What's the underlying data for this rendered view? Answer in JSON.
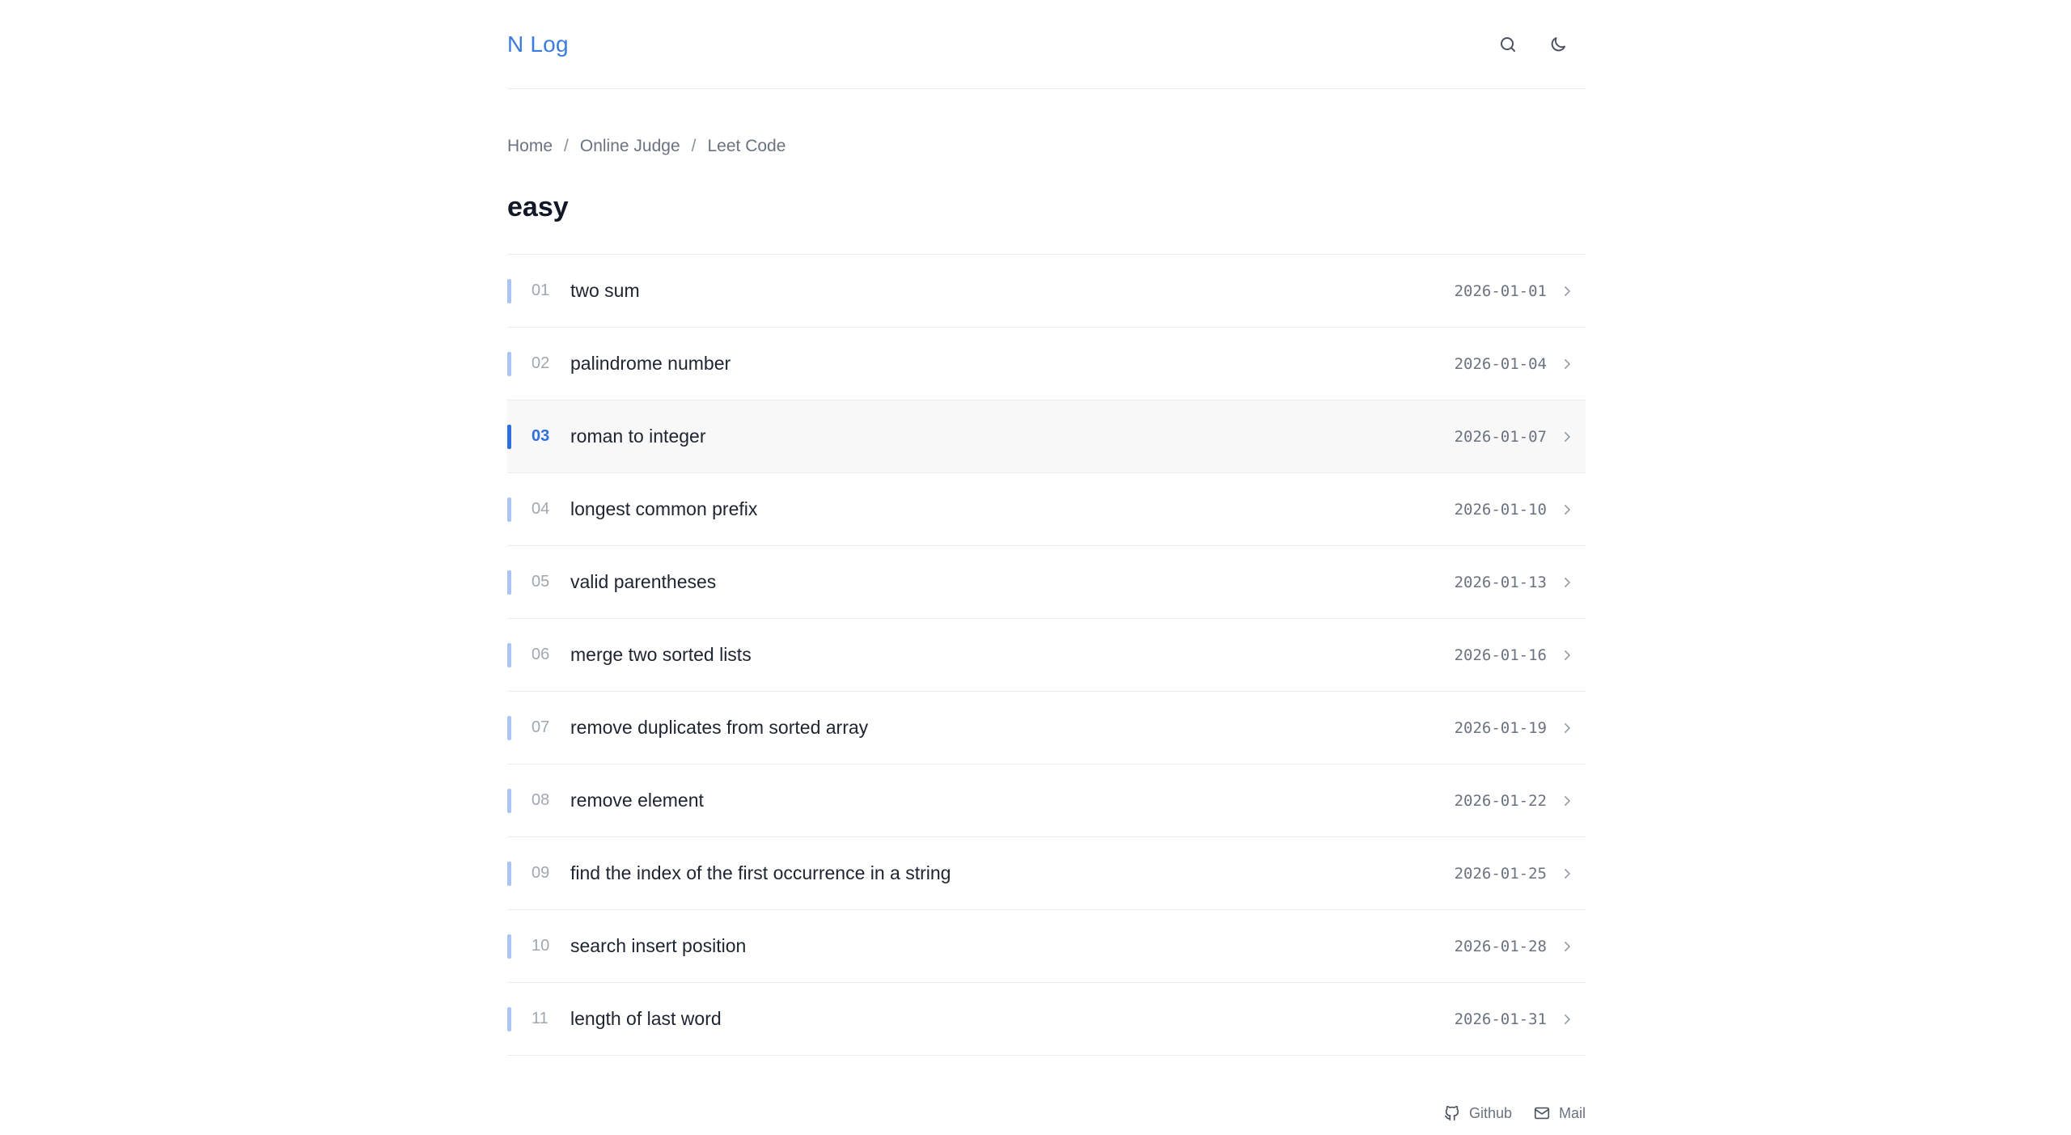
{
  "header": {
    "logo": "N Log",
    "search_icon": "search-icon",
    "theme_icon": "moon-icon"
  },
  "breadcrumb": [
    "Home",
    "Online Judge",
    "Leet Code"
  ],
  "breadcrumb_separator": "/",
  "page_title": "easy",
  "posts": [
    {
      "num": "01",
      "title": "two sum",
      "date": "2026-01-01"
    },
    {
      "num": "02",
      "title": "palindrome number",
      "date": "2026-01-04"
    },
    {
      "num": "03",
      "title": "roman to integer",
      "date": "2026-01-07",
      "active": true
    },
    {
      "num": "04",
      "title": "longest common prefix",
      "date": "2026-01-10"
    },
    {
      "num": "05",
      "title": "valid parentheses",
      "date": "2026-01-13"
    },
    {
      "num": "06",
      "title": "merge two sorted lists",
      "date": "2026-01-16"
    },
    {
      "num": "07",
      "title": "remove duplicates from sorted array",
      "date": "2026-01-19"
    },
    {
      "num": "08",
      "title": "remove element",
      "date": "2026-01-22"
    },
    {
      "num": "09",
      "title": "find the index of the first occurrence in a string",
      "date": "2026-01-25"
    },
    {
      "num": "10",
      "title": "search insert position",
      "date": "2026-01-28"
    },
    {
      "num": "11",
      "title": "length of last word",
      "date": "2026-01-31"
    }
  ],
  "footer": {
    "github_label": "Github",
    "mail_label": "Mail"
  },
  "colors": {
    "accent": "#3b7ddd",
    "active_bar": "#2f6fe0",
    "bar": "#a9c4f5"
  }
}
